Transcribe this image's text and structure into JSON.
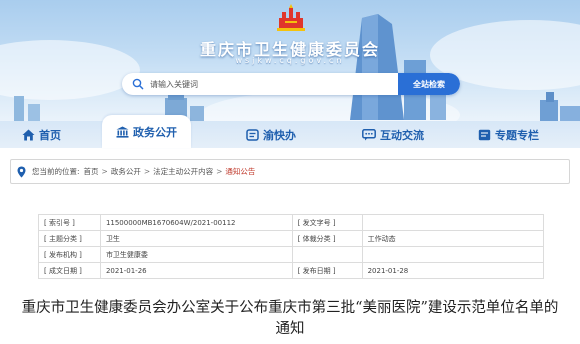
{
  "header": {
    "site_title": "重庆市卫生健康委员会",
    "site_domain": "wsjkw.cq.gov.cn",
    "search": {
      "placeholder": "请输入关键词",
      "button_label": "全站检索"
    }
  },
  "nav": {
    "items": [
      {
        "label": "首页",
        "icon": "home-icon"
      },
      {
        "label": "政务公开",
        "icon": "government-building-icon",
        "active": true
      },
      {
        "label": "渝快办",
        "icon": "service-icon"
      },
      {
        "label": "互动交流",
        "icon": "chat-icon"
      },
      {
        "label": "专题专栏",
        "icon": "topic-icon"
      }
    ]
  },
  "breadcrumb": {
    "prefix": "您当前的位置:",
    "items": [
      "首页",
      "政务公开",
      "法定主动公开内容",
      "通知公告"
    ],
    "separator": ">"
  },
  "metadata": {
    "rows": [
      {
        "label1": "[ 索引号 ]",
        "value1": "11500000MB1670604W/2021-00112",
        "label2": "[ 发文字号 ]",
        "value2": ""
      },
      {
        "label1": "[ 主题分类 ]",
        "value1": "卫生",
        "label2": "[ 体裁分类 ]",
        "value2": "工作动态"
      },
      {
        "label1": "[ 发布机构 ]",
        "value1": "市卫生健康委",
        "label2": "",
        "value2": ""
      },
      {
        "label1": "[ 成文日期 ]",
        "value1": "2021-01-26",
        "label2": "[ 发布日期 ]",
        "value2": "2021-01-28"
      }
    ]
  },
  "article": {
    "title": "重庆市卫生健康委员会办公室关于公布重庆市第三批“美丽医院”建设示范单位名单的通知"
  },
  "colors": {
    "accent": "#2a6fd6",
    "nav_text": "#1f5fae",
    "breadcrumb_active": "#c0392b",
    "banner_sky": "#a9cdee"
  }
}
